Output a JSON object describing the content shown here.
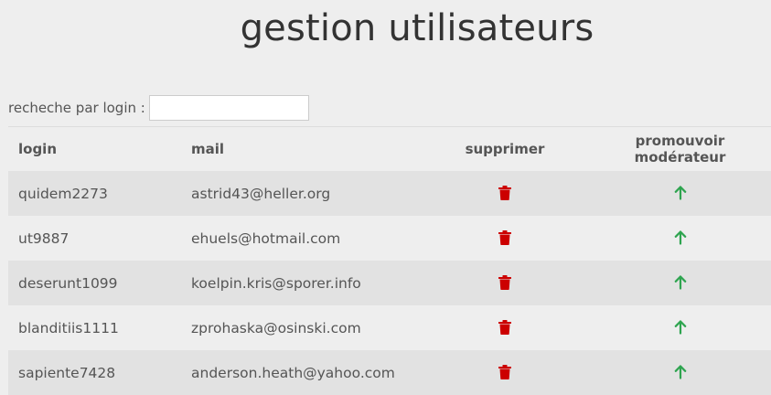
{
  "page": {
    "title": "gestion utilisateurs"
  },
  "search": {
    "label": "recheche par login :",
    "value": "",
    "placeholder": ""
  },
  "table": {
    "columns": [
      "login",
      "mail",
      "supprimer",
      "promouvoir modérateur"
    ],
    "rows": [
      {
        "login": "quidem2273",
        "mail": "astrid43@heller.org",
        "delete_icon": "trash-icon",
        "promote_icon": "arrow-up-icon"
      },
      {
        "login": "ut9887",
        "mail": "ehuels@hotmail.com",
        "delete_icon": "trash-icon",
        "promote_icon": "arrow-up-icon"
      },
      {
        "login": "deserunt1099",
        "mail": "koelpin.kris@sporer.info",
        "delete_icon": "trash-icon",
        "promote_icon": "arrow-up-icon"
      },
      {
        "login": "blanditiis1111",
        "mail": "zprohaska@osinski.com",
        "delete_icon": "trash-icon",
        "promote_icon": "arrow-up-icon"
      },
      {
        "login": "sapiente7428",
        "mail": "anderson.heath@yahoo.com",
        "delete_icon": "trash-icon",
        "promote_icon": "arrow-up-icon"
      }
    ]
  },
  "colors": {
    "delete": "#cc0000",
    "promote": "#2ea44f",
    "row_striped": "#e2e2e2",
    "background": "#eeeeee"
  }
}
